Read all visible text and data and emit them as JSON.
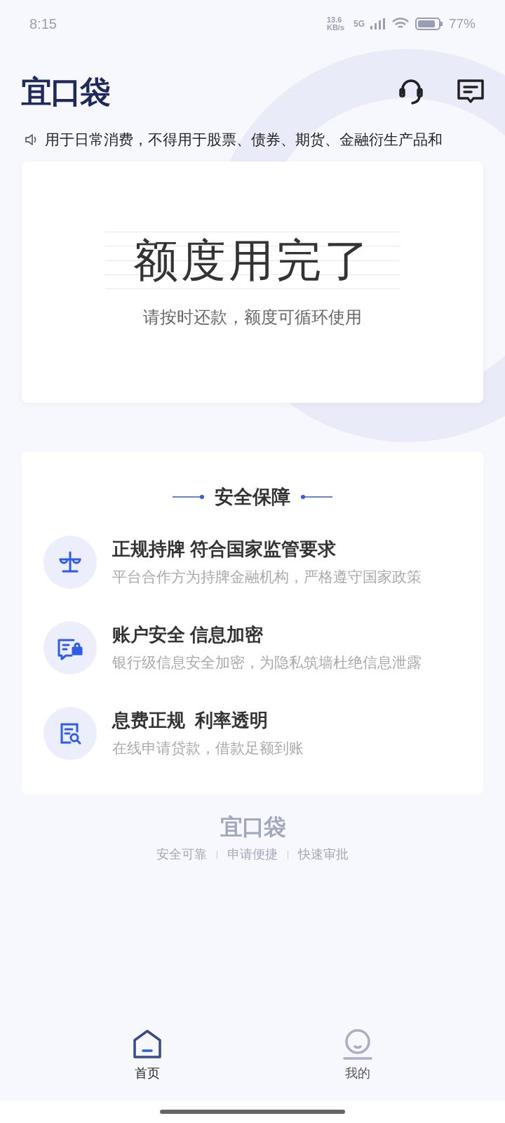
{
  "status_bar": {
    "time": "8:15",
    "net_speed": "13.6 KB/s",
    "network": "5G",
    "battery": "77%"
  },
  "header": {
    "logo": "宜口袋"
  },
  "notice": "用于日常消费，不得用于股票、债券、期货、金融衍生产品和",
  "quota_card": {
    "title": "额度用完了",
    "subtitle": "请按时还款，额度可循环使用"
  },
  "security": {
    "title": "安全保障",
    "items": [
      {
        "kind": "scale",
        "title": "正规持牌 符合国家监管要求",
        "desc": "平台合作方为持牌金融机构，严格遵守国家政策"
      },
      {
        "kind": "chat-lock",
        "title": "账户安全 信息加密",
        "desc": "银行级信息安全加密，为隐私筑墙杜绝信息泄露"
      },
      {
        "kind": "doc-search",
        "title": "息费正规  利率透明",
        "desc": "在线申请贷款，借款足额到账"
      }
    ]
  },
  "footer": {
    "logo": "宜口袋",
    "taglines": [
      "安全可靠",
      "申请便捷",
      "快速审批"
    ]
  },
  "tabs": [
    {
      "kind": "home",
      "label": "首页",
      "selected": true
    },
    {
      "kind": "profile",
      "label": "我的",
      "selected": false
    }
  ]
}
